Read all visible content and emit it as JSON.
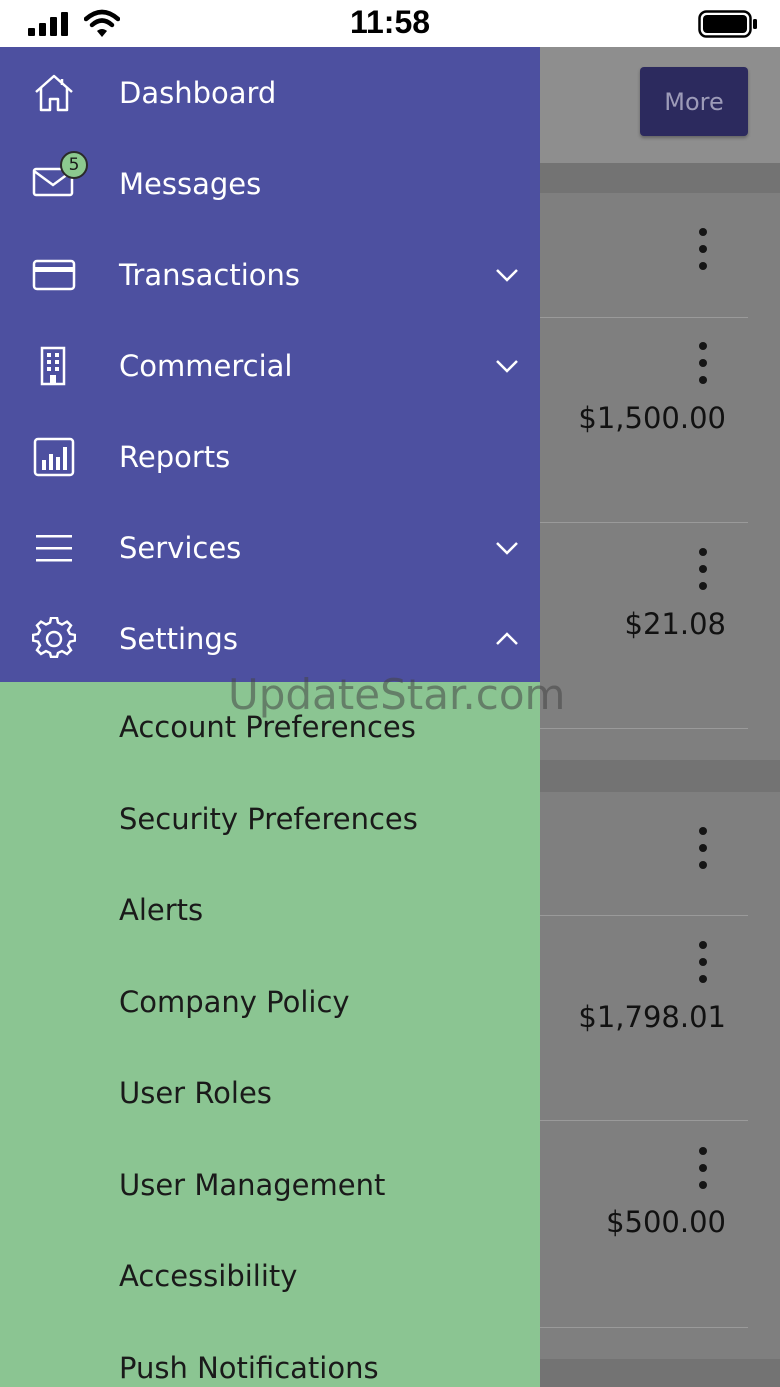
{
  "status_bar": {
    "time": "11:58"
  },
  "header": {
    "more_label": "More"
  },
  "amounts": [
    "$1,500.00",
    "$21.08",
    "$1,798.01",
    "$500.00"
  ],
  "nav": {
    "dashboard": {
      "label": "Dashboard",
      "icon": "home-icon"
    },
    "messages": {
      "label": "Messages",
      "icon": "mail-icon",
      "badge": "5"
    },
    "transactions": {
      "label": "Transactions",
      "icon": "card-icon"
    },
    "commercial": {
      "label": "Commercial",
      "icon": "building-icon"
    },
    "reports": {
      "label": "Reports",
      "icon": "bar-chart-icon"
    },
    "services": {
      "label": "Services",
      "icon": "menu-icon"
    },
    "settings": {
      "label": "Settings",
      "icon": "gear-icon"
    }
  },
  "settings_submenu": [
    "Account Preferences",
    "Security Preferences",
    "Alerts",
    "Company Policy",
    "User Roles",
    "User Management",
    "Accessibility",
    "Push Notifications"
  ],
  "watermark": "UpdateStar.com",
  "colors": {
    "drawer": "#4d50a0",
    "submenu": "#8bc592",
    "more_button": "#2c2a5e"
  }
}
